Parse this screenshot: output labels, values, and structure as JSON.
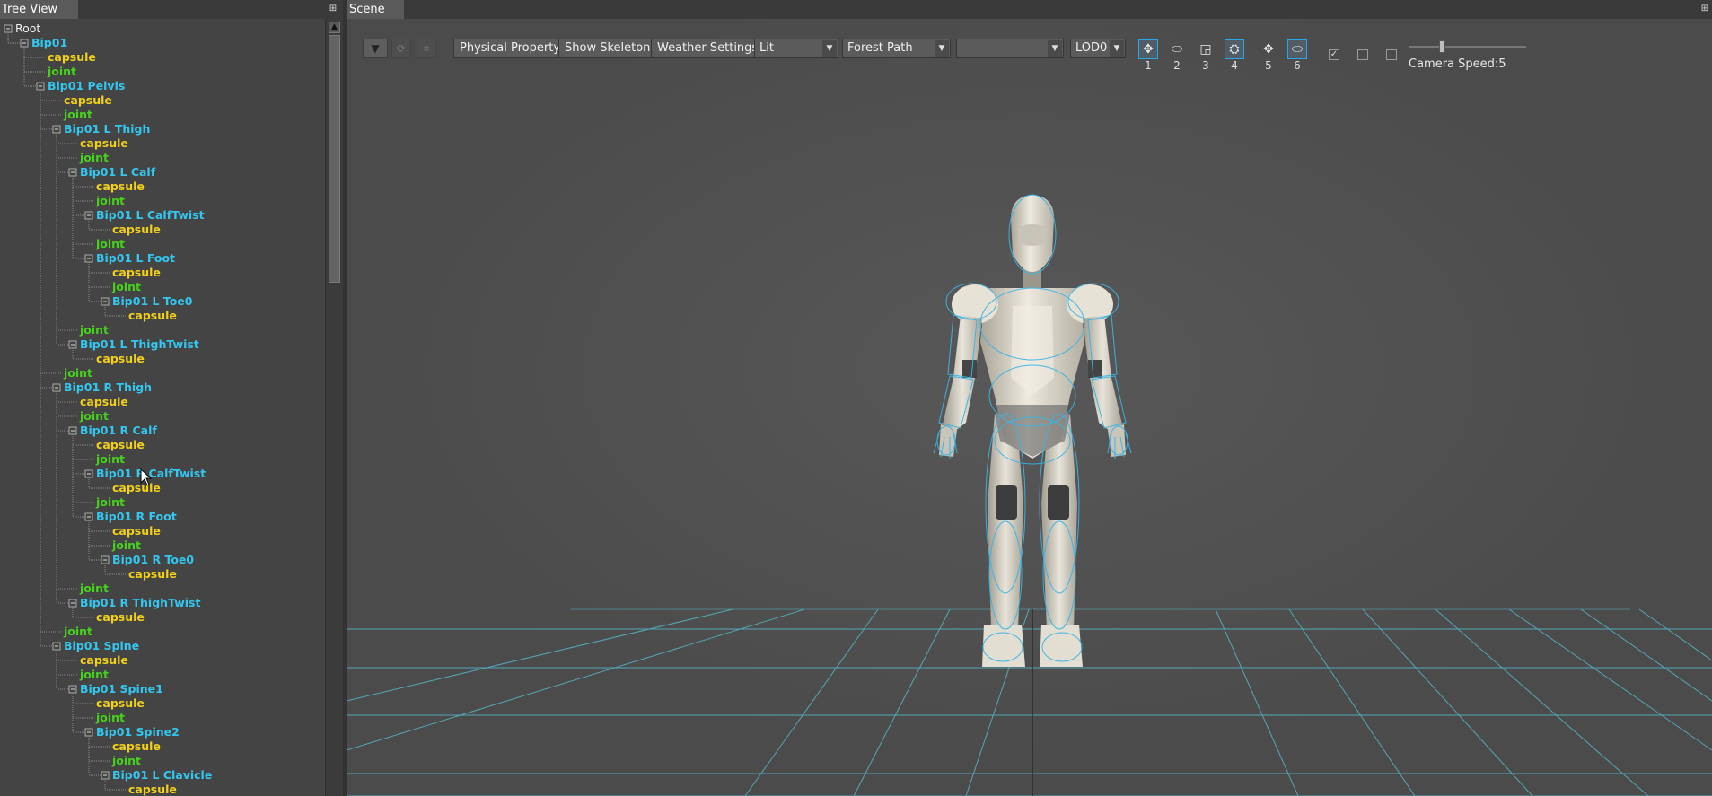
{
  "tree_panel": {
    "tab_label": "Tree View",
    "pin_icon": "dock-pin-icon",
    "scroll_up_icon": "arrow-up-icon",
    "nodes": [
      {
        "label": "Root",
        "kind": "root",
        "level": 0,
        "expanded": true
      },
      {
        "label": "Bip01",
        "kind": "node",
        "level": 1,
        "expanded": true
      },
      {
        "label": "capsule",
        "kind": "capsule",
        "level": 2
      },
      {
        "label": "joint",
        "kind": "joint",
        "level": 2
      },
      {
        "label": "Bip01 Pelvis",
        "kind": "node",
        "level": 2,
        "expanded": true
      },
      {
        "label": "capsule",
        "kind": "capsule",
        "level": 3
      },
      {
        "label": "joint",
        "kind": "joint",
        "level": 3
      },
      {
        "label": "Bip01 L Thigh",
        "kind": "node",
        "level": 3,
        "expanded": true
      },
      {
        "label": "capsule",
        "kind": "capsule",
        "level": 4
      },
      {
        "label": "joint",
        "kind": "joint",
        "level": 4
      },
      {
        "label": "Bip01 L Calf",
        "kind": "node",
        "level": 4,
        "expanded": true
      },
      {
        "label": "capsule",
        "kind": "capsule",
        "level": 5
      },
      {
        "label": "joint",
        "kind": "joint",
        "level": 5
      },
      {
        "label": "Bip01 L CalfTwist",
        "kind": "node",
        "level": 5,
        "expanded": true
      },
      {
        "label": "capsule",
        "kind": "capsule",
        "level": 6
      },
      {
        "label": "joint",
        "kind": "joint",
        "level": 5
      },
      {
        "label": "Bip01 L Foot",
        "kind": "node",
        "level": 5,
        "expanded": true
      },
      {
        "label": "capsule",
        "kind": "capsule",
        "level": 6
      },
      {
        "label": "joint",
        "kind": "joint",
        "level": 6
      },
      {
        "label": "Bip01 L Toe0",
        "kind": "node",
        "level": 6,
        "expanded": true
      },
      {
        "label": "capsule",
        "kind": "capsule",
        "level": 7
      },
      {
        "label": "joint",
        "kind": "joint",
        "level": 4
      },
      {
        "label": "Bip01 L ThighTwist",
        "kind": "node",
        "level": 4,
        "expanded": true
      },
      {
        "label": "capsule",
        "kind": "capsule",
        "level": 5
      },
      {
        "label": "joint",
        "kind": "joint",
        "level": 3
      },
      {
        "label": "Bip01 R Thigh",
        "kind": "node",
        "level": 3,
        "expanded": true
      },
      {
        "label": "capsule",
        "kind": "capsule",
        "level": 4
      },
      {
        "label": "joint",
        "kind": "joint",
        "level": 4
      },
      {
        "label": "Bip01 R Calf",
        "kind": "node",
        "level": 4,
        "expanded": true
      },
      {
        "label": "capsule",
        "kind": "capsule",
        "level": 5
      },
      {
        "label": "joint",
        "kind": "joint",
        "level": 5
      },
      {
        "label": "Bip01 R CalfTwist",
        "kind": "node",
        "level": 5,
        "expanded": true
      },
      {
        "label": "capsule",
        "kind": "capsule",
        "level": 6
      },
      {
        "label": "joint",
        "kind": "joint",
        "level": 5
      },
      {
        "label": "Bip01 R Foot",
        "kind": "node",
        "level": 5,
        "expanded": true
      },
      {
        "label": "capsule",
        "kind": "capsule",
        "level": 6
      },
      {
        "label": "joint",
        "kind": "joint",
        "level": 6
      },
      {
        "label": "Bip01 R Toe0",
        "kind": "node",
        "level": 6,
        "expanded": true
      },
      {
        "label": "capsule",
        "kind": "capsule",
        "level": 7
      },
      {
        "label": "joint",
        "kind": "joint",
        "level": 4
      },
      {
        "label": "Bip01 R ThighTwist",
        "kind": "node",
        "level": 4,
        "expanded": true
      },
      {
        "label": "capsule",
        "kind": "capsule",
        "level": 5
      },
      {
        "label": "joint",
        "kind": "joint",
        "level": 3
      },
      {
        "label": "Bip01 Spine",
        "kind": "node",
        "level": 3,
        "expanded": true
      },
      {
        "label": "capsule",
        "kind": "capsule",
        "level": 4
      },
      {
        "label": "joint",
        "kind": "joint",
        "level": 4
      },
      {
        "label": "Bip01 Spine1",
        "kind": "node",
        "level": 4,
        "expanded": true
      },
      {
        "label": "capsule",
        "kind": "capsule",
        "level": 5
      },
      {
        "label": "joint",
        "kind": "joint",
        "level": 5
      },
      {
        "label": "Bip01 Spine2",
        "kind": "node",
        "level": 5,
        "expanded": true
      },
      {
        "label": "capsule",
        "kind": "capsule",
        "level": 6
      },
      {
        "label": "joint",
        "kind": "joint",
        "level": 6
      },
      {
        "label": "Bip01 L Clavicle",
        "kind": "node",
        "level": 6,
        "expanded": true
      },
      {
        "label": "capsule",
        "kind": "capsule",
        "level": 7
      }
    ]
  },
  "scene_panel": {
    "tab_label": "Scene",
    "maximize_icon": "maximize-icon",
    "toolbar": {
      "view_menu_icon": "dropdown-menu-icon",
      "refresh_icon": "refresh-icon",
      "grid_toggle_icon": "grid-icon",
      "physical_property_label": "Physical Property",
      "show_skeleton_label": "Show Skeleton",
      "weather_settings_label": "Weather Settings",
      "shading_mode": "Lit",
      "environment": "Forest Path",
      "extra_combo": "",
      "lod": "LOD0"
    },
    "gizmos": [
      {
        "number": "1",
        "icon": "move-gizmo-icon",
        "selected": true
      },
      {
        "number": "2",
        "icon": "rotate-gizmo-icon",
        "selected": false
      },
      {
        "number": "3",
        "icon": "scale-gizmo-icon",
        "selected": false
      },
      {
        "number": "4",
        "icon": "character-gizmo-icon",
        "selected": true
      },
      {
        "number": "5",
        "icon": "move-local-icon",
        "selected": false
      },
      {
        "number": "6",
        "icon": "rotate-local-icon",
        "selected": true
      }
    ],
    "checkboxes": [
      {
        "checked": true
      },
      {
        "checked": false
      },
      {
        "checked": false
      }
    ],
    "camera_speed_label": "Camera Speed:5",
    "camera_speed_value": 5,
    "colors": {
      "viewport_bg": "#4b4b4b",
      "grid_line": "#56b6c8",
      "skeleton_wire": "#3ab4e6",
      "node_text": "#33c6ee",
      "capsule_text": "#f2d019",
      "joint_text": "#46d21c"
    }
  }
}
